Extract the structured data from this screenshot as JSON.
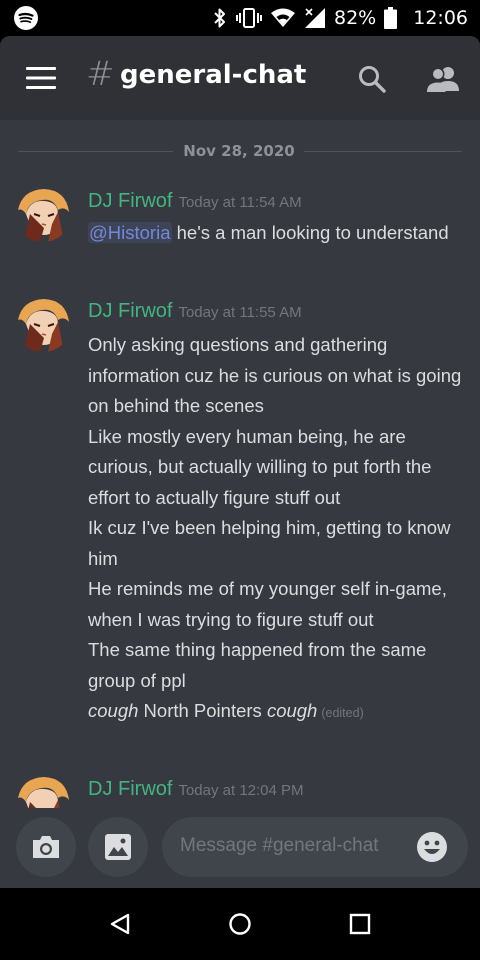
{
  "status_bar": {
    "battery": "82%",
    "time": "12:06",
    "icons": [
      "spotify-icon",
      "bluetooth-icon",
      "vibrate-icon",
      "wifi-icon",
      "signal-icon",
      "battery-icon"
    ]
  },
  "header": {
    "hash": "#",
    "channel": "general-chat",
    "icons": [
      "menu-icon",
      "search-icon",
      "members-icon"
    ]
  },
  "date_divider": "Nov 28, 2020",
  "messages": [
    {
      "author": "DJ Firwof",
      "timestamp": "Today at 11:54 AM",
      "mention": "@Historia",
      "text_after_mention": " he's a man looking to understand"
    },
    {
      "author": "DJ Firwof",
      "timestamp": "Today at 11:55 AM",
      "lines": [
        "Only asking questions and gathering information cuz he is curious on what is going on behind the scenes",
        "Like mostly every human being, he are curious, but actually willing to put forth the effort to actually figure stuff out",
        "Ik cuz I've been helping him, getting to know him",
        "He reminds me of my younger self in-game, when I was trying to figure stuff out",
        "The same thing happened from the same group of ppl"
      ],
      "last_line": {
        "italic_1": "cough",
        "middle": " North Pointers ",
        "italic_2": "cough",
        "edited": "(edited)"
      }
    },
    {
      "author": "DJ Firwof",
      "timestamp": "Today at 12:04 PM"
    }
  ],
  "input": {
    "placeholder": "Message #general-chat",
    "icons": [
      "camera-icon",
      "image-icon",
      "emoji-icon"
    ]
  },
  "nav": {
    "icons": [
      "back-icon",
      "home-icon",
      "recents-icon"
    ]
  },
  "colors": {
    "background": "#36393f",
    "header": "#2f3136",
    "author": "#43b581",
    "mention": "#7289da"
  }
}
